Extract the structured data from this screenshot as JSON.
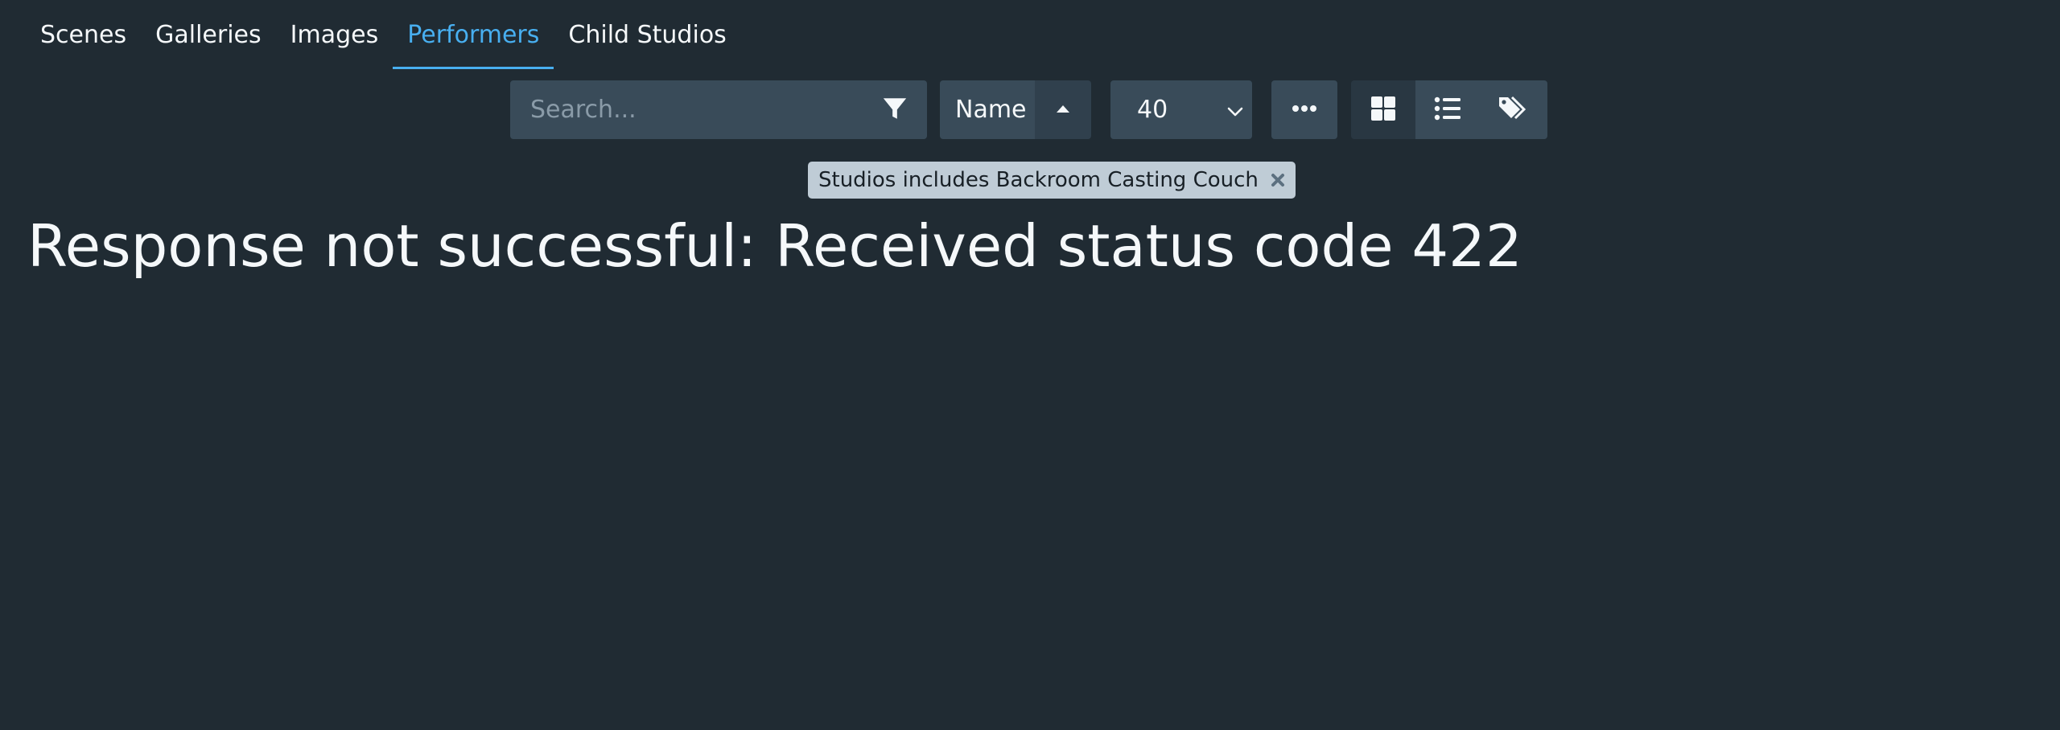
{
  "tabs": [
    {
      "label": "Scenes",
      "active": false
    },
    {
      "label": "Galleries",
      "active": false
    },
    {
      "label": "Images",
      "active": false
    },
    {
      "label": "Performers",
      "active": true
    },
    {
      "label": "Child Studios",
      "active": false
    }
  ],
  "toolbar": {
    "search_placeholder": "Search...",
    "search_value": "",
    "sort_field": "Name",
    "sort_direction": "ascending",
    "page_size": "40"
  },
  "filter_tag": {
    "label": "Studios includes Backroom Casting Couch"
  },
  "error": {
    "message": "Response not successful: Received status code 422"
  },
  "colors": {
    "background": "#202b33",
    "button": "#394b59",
    "accent": "#48aff0",
    "tag_background": "#bfccd6"
  },
  "icons": {
    "filter": "filter-icon",
    "sort_direction": "caret-up-icon",
    "page_size_dropdown": "chevron-down-icon",
    "more": "ellipsis-icon",
    "grid_view": "grid-icon",
    "list_view": "list-icon",
    "tagger_view": "tags-icon",
    "remove_filter": "close-icon"
  }
}
